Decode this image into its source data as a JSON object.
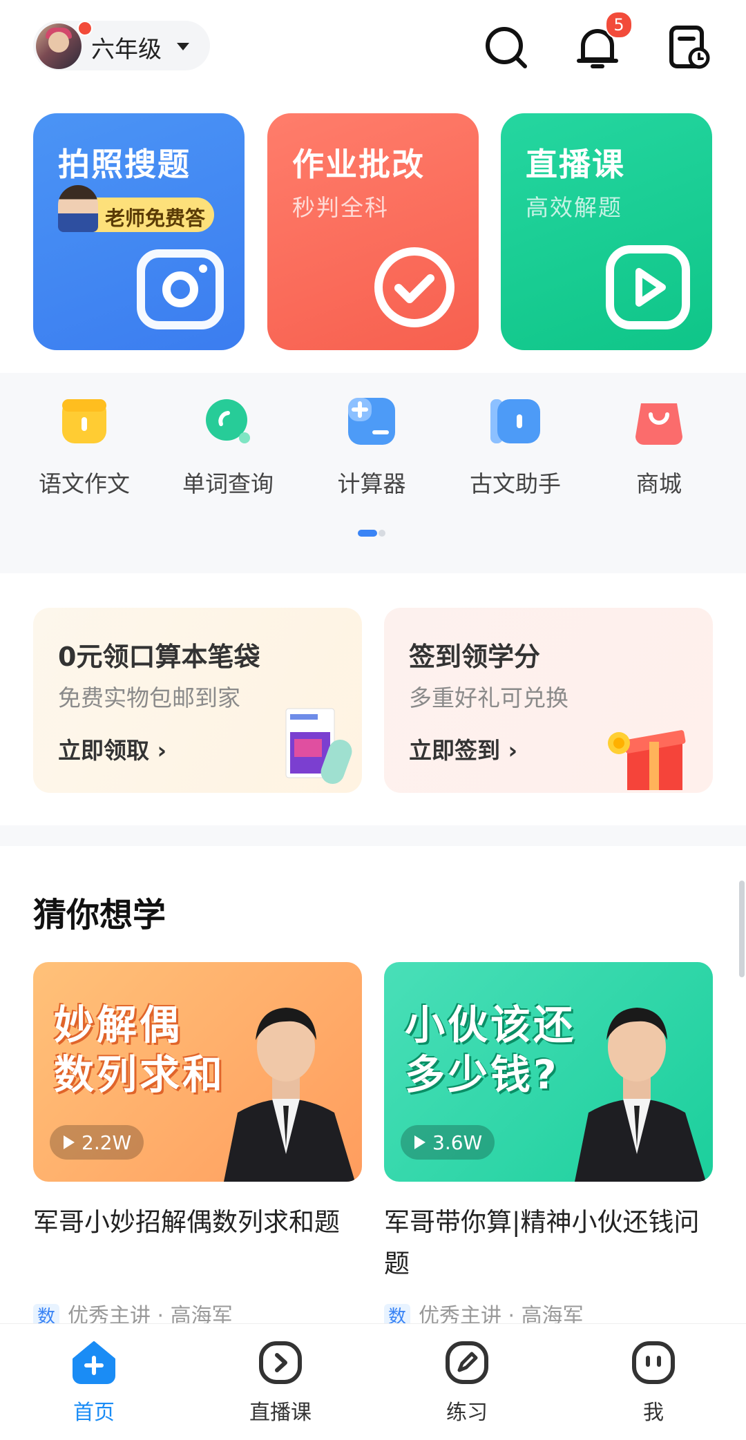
{
  "header": {
    "grade": "六年级",
    "notification_count": "5"
  },
  "feature_cards": [
    {
      "title": "拍照搜题",
      "tag": "老师免费答"
    },
    {
      "title": "作业批改",
      "subtitle": "秒判全科"
    },
    {
      "title": "直播课",
      "subtitle": "高效解题"
    }
  ],
  "tools": [
    {
      "label": "语文作文"
    },
    {
      "label": "单词查询"
    },
    {
      "label": "计算器"
    },
    {
      "label": "古文助手"
    },
    {
      "label": "商城"
    }
  ],
  "promos": [
    {
      "title": "0元领口算本笔袋",
      "subtitle": "免费实物包邮到家",
      "action": "立即领取 ›"
    },
    {
      "title": "签到领学分",
      "subtitle": "多重好礼可兑换",
      "action": "立即签到 ›"
    }
  ],
  "guess": {
    "section_title": "猜你想学",
    "videos": [
      {
        "cover_text": "妙解偶\n数列求和",
        "views": "2.2W",
        "title": "军哥小妙招解偶数列求和题",
        "subject": "数",
        "meta": "优秀主讲 · 高海军"
      },
      {
        "cover_text": "小伙该还\n多少钱?",
        "views": "3.6W",
        "title": "军哥带你算|精神小伙还钱问题",
        "subject": "数",
        "meta": "优秀主讲 · 高海军"
      }
    ]
  },
  "bottom_nav": [
    {
      "label": "首页",
      "active": true
    },
    {
      "label": "直播课"
    },
    {
      "label": "练习"
    },
    {
      "label": "我"
    }
  ],
  "colors": {
    "accent": "#1a8cf5",
    "card_blue": "#4286f4",
    "card_red": "#f96a57",
    "card_green": "#16cc90",
    "badge_red": "#f24b3a"
  }
}
